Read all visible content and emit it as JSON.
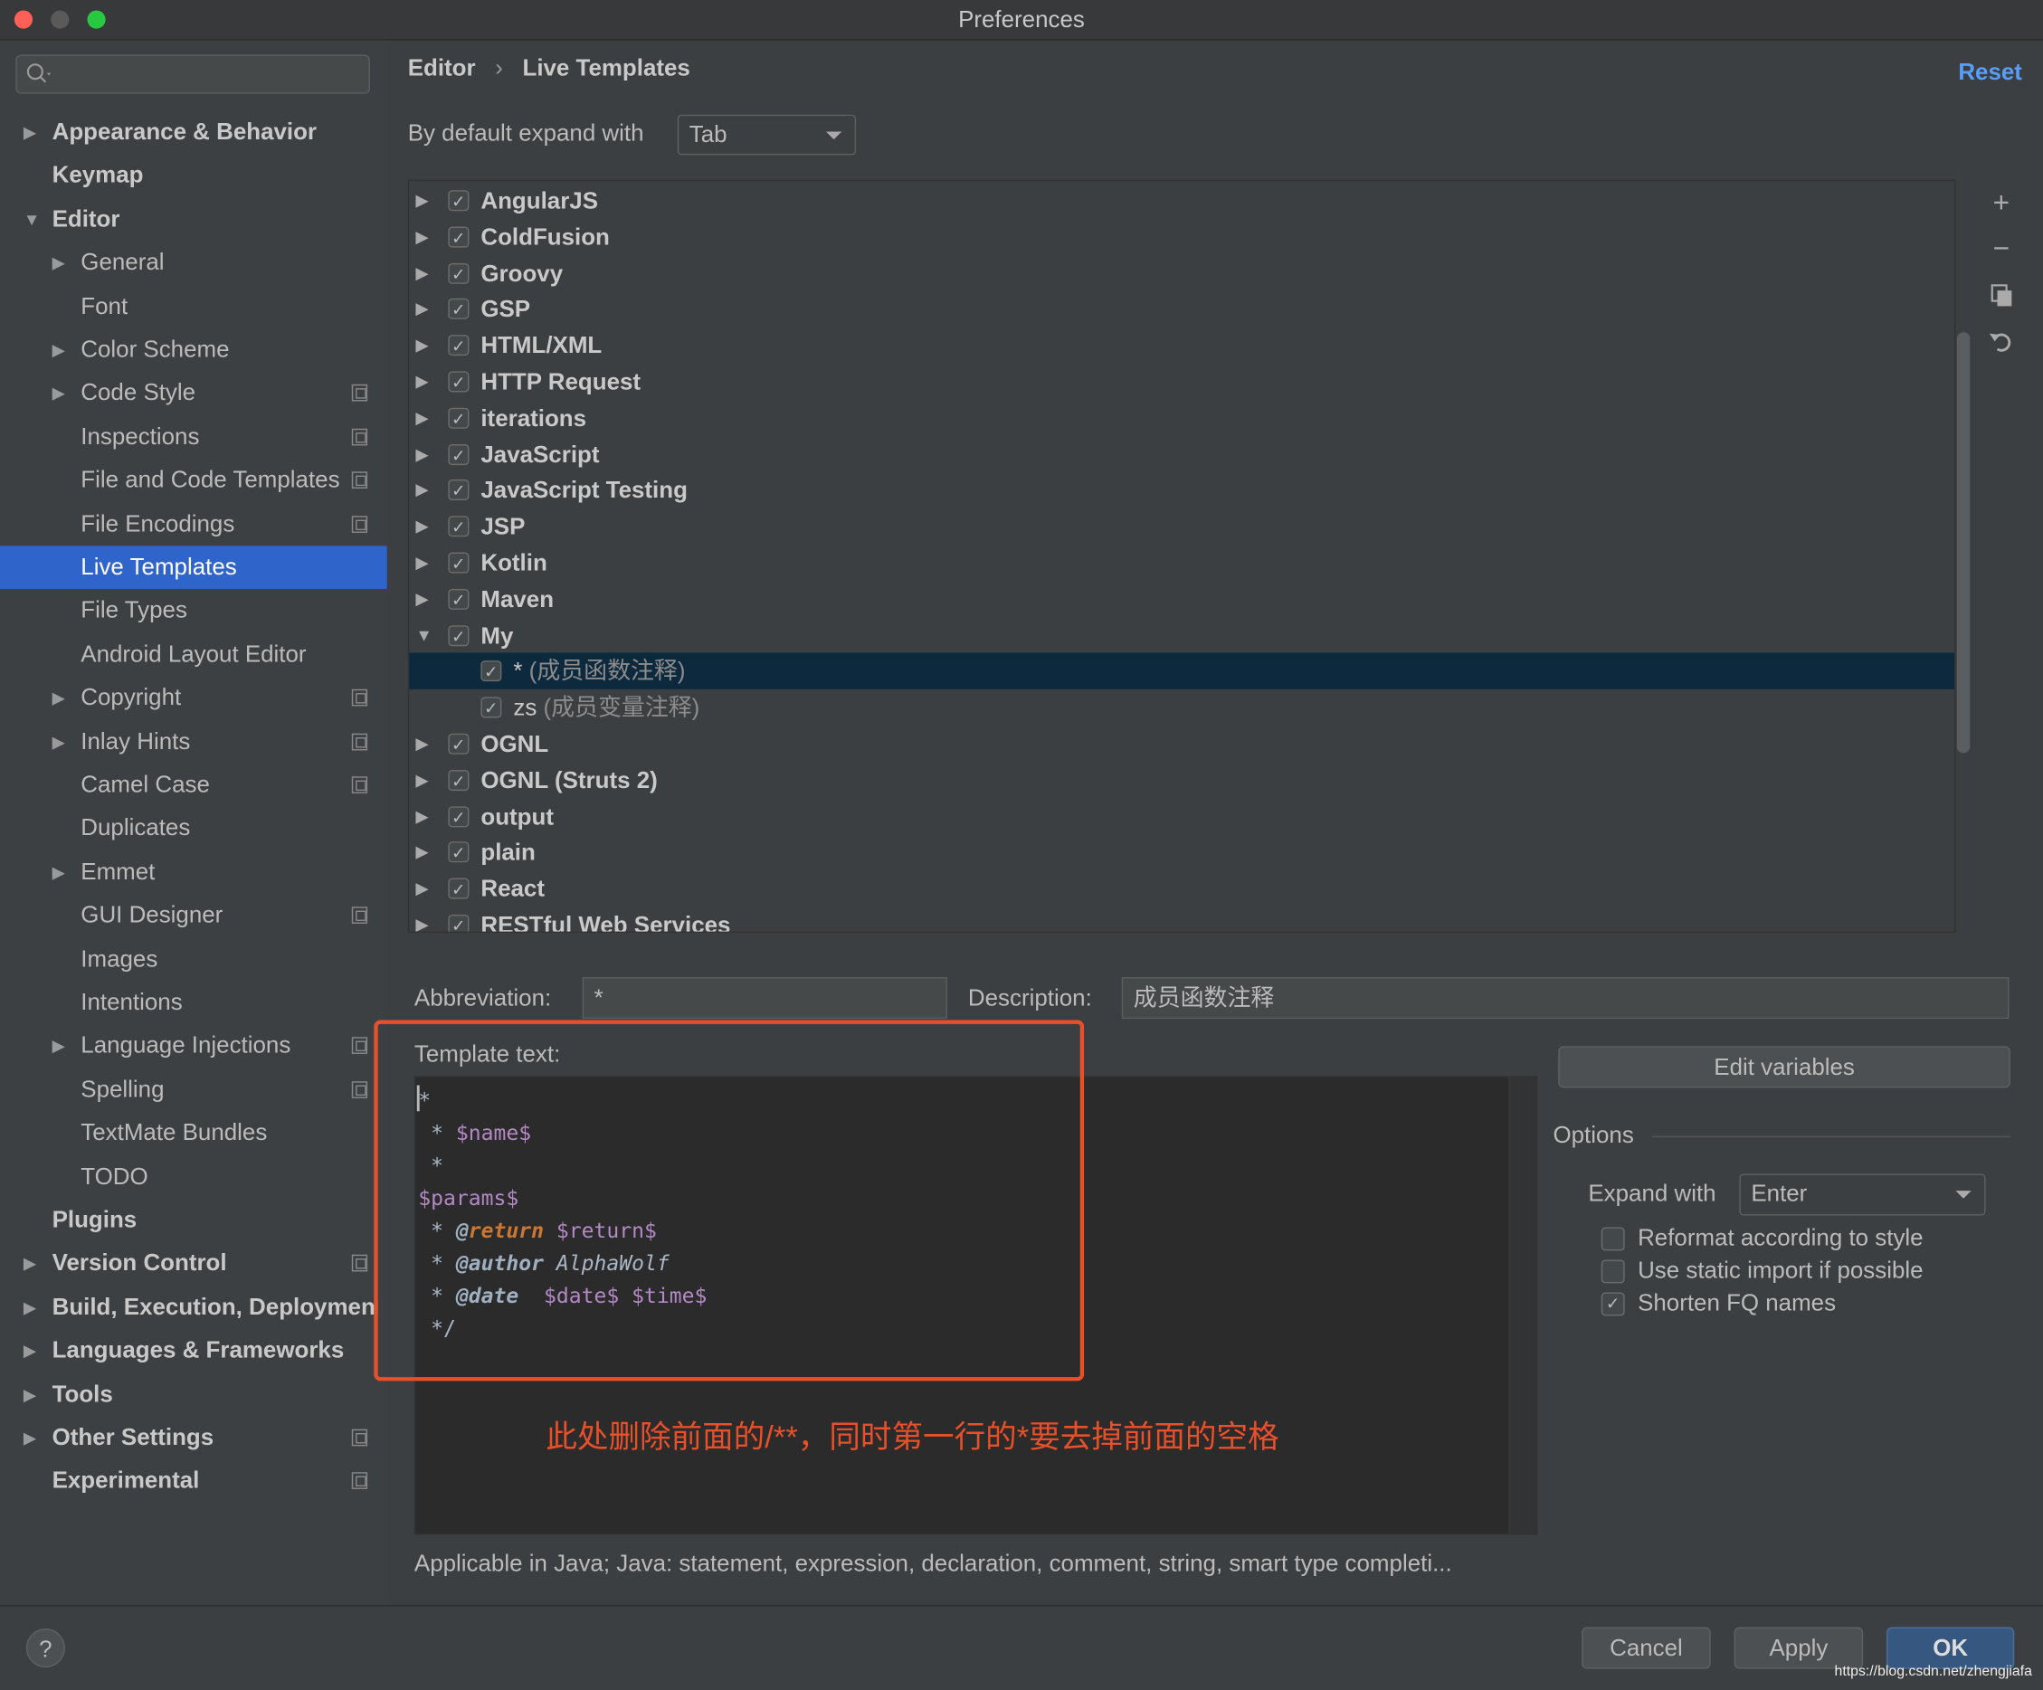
{
  "window": {
    "title": "Preferences",
    "traffic_lights": [
      "#fe5f57",
      "#5a5a5a",
      "#28c840"
    ]
  },
  "sidebar": {
    "search_placeholder": "",
    "items": [
      {
        "label": "Appearance & Behavior",
        "level": 0,
        "arrow": "right",
        "bold": true
      },
      {
        "label": "Keymap",
        "level": 0,
        "bold": true
      },
      {
        "label": "Editor",
        "level": 0,
        "arrow": "down",
        "bold": true
      },
      {
        "label": "General",
        "level": 1,
        "arrow": "right"
      },
      {
        "label": "Font",
        "level": 1
      },
      {
        "label": "Color Scheme",
        "level": 1,
        "arrow": "right"
      },
      {
        "label": "Code Style",
        "level": 1,
        "arrow": "right",
        "copy": true
      },
      {
        "label": "Inspections",
        "level": 1,
        "copy": true
      },
      {
        "label": "File and Code Templates",
        "level": 1,
        "copy": true
      },
      {
        "label": "File Encodings",
        "level": 1,
        "copy": true
      },
      {
        "label": "Live Templates",
        "level": 1,
        "selected": true
      },
      {
        "label": "File Types",
        "level": 1
      },
      {
        "label": "Android Layout Editor",
        "level": 1
      },
      {
        "label": "Copyright",
        "level": 1,
        "arrow": "right",
        "copy": true
      },
      {
        "label": "Inlay Hints",
        "level": 1,
        "arrow": "right",
        "copy": true
      },
      {
        "label": "Camel Case",
        "level": 1,
        "copy": true
      },
      {
        "label": "Duplicates",
        "level": 1
      },
      {
        "label": "Emmet",
        "level": 1,
        "arrow": "right"
      },
      {
        "label": "GUI Designer",
        "level": 1,
        "copy": true
      },
      {
        "label": "Images",
        "level": 1
      },
      {
        "label": "Intentions",
        "level": 1
      },
      {
        "label": "Language Injections",
        "level": 1,
        "arrow": "right",
        "copy": true
      },
      {
        "label": "Spelling",
        "level": 1,
        "copy": true
      },
      {
        "label": "TextMate Bundles",
        "level": 1
      },
      {
        "label": "TODO",
        "level": 1
      },
      {
        "label": "Plugins",
        "level": 0,
        "bold": true
      },
      {
        "label": "Version Control",
        "level": 0,
        "arrow": "right",
        "bold": true,
        "copy": true
      },
      {
        "label": "Build, Execution, Deployment",
        "level": 0,
        "arrow": "right",
        "bold": true
      },
      {
        "label": "Languages & Frameworks",
        "level": 0,
        "arrow": "right",
        "bold": true
      },
      {
        "label": "Tools",
        "level": 0,
        "arrow": "right",
        "bold": true
      },
      {
        "label": "Other Settings",
        "level": 0,
        "arrow": "right",
        "bold": true,
        "copy": true
      },
      {
        "label": "Experimental",
        "level": 0,
        "bold": true,
        "copy": true
      }
    ]
  },
  "header": {
    "breadcrumb": [
      "Editor",
      "Live Templates"
    ],
    "separator": "›",
    "reset": "Reset",
    "reset_color": "#589df6"
  },
  "expand_default": {
    "label": "By default expand with",
    "value": "Tab"
  },
  "tree": [
    {
      "label": "AngularJS",
      "checked": true,
      "arrow": "right"
    },
    {
      "label": "ColdFusion",
      "checked": true,
      "arrow": "right"
    },
    {
      "label": "Groovy",
      "checked": true,
      "arrow": "right"
    },
    {
      "label": "GSP",
      "checked": true,
      "arrow": "right"
    },
    {
      "label": "HTML/XML",
      "checked": true,
      "arrow": "right"
    },
    {
      "label": "HTTP Request",
      "checked": true,
      "arrow": "right"
    },
    {
      "label": "iterations",
      "checked": true,
      "arrow": "right"
    },
    {
      "label": "JavaScript",
      "checked": true,
      "arrow": "right"
    },
    {
      "label": "JavaScript Testing",
      "checked": true,
      "arrow": "right"
    },
    {
      "label": "JSP",
      "checked": true,
      "arrow": "right"
    },
    {
      "label": "Kotlin",
      "checked": true,
      "arrow": "right"
    },
    {
      "label": "Maven",
      "checked": true,
      "arrow": "right"
    },
    {
      "label": "My",
      "checked": true,
      "arrow": "down"
    },
    {
      "label": "*",
      "desc": "(成员函数注释)",
      "checked": true,
      "leaf": true,
      "selected": true
    },
    {
      "label": "zs",
      "desc": "(成员变量注释)",
      "checked": true,
      "leaf": true
    },
    {
      "label": "OGNL",
      "checked": true,
      "arrow": "right"
    },
    {
      "label": "OGNL (Struts 2)",
      "checked": true,
      "arrow": "right"
    },
    {
      "label": "output",
      "checked": true,
      "arrow": "right"
    },
    {
      "label": "plain",
      "checked": true,
      "arrow": "right"
    },
    {
      "label": "React",
      "checked": true,
      "arrow": "right"
    },
    {
      "label": "RESTful Web Services",
      "checked": true,
      "arrow": "right"
    }
  ],
  "tree_toolbar": [
    "plus-icon",
    "minus-icon",
    "copy-icon",
    "revert-icon"
  ],
  "abbreviation": {
    "label": "Abbreviation:",
    "value": "*"
  },
  "description": {
    "label": "Description:",
    "value": "成员函数注释"
  },
  "template": {
    "label": "Template text:",
    "lines": [
      [
        {
          "t": "*",
          "c": ""
        }
      ],
      [
        {
          "t": " * ",
          "c": ""
        },
        {
          "t": "$name$",
          "c": "var"
        }
      ],
      [
        {
          "t": " *",
          "c": ""
        }
      ],
      [
        {
          "t": "$params$",
          "c": "var"
        }
      ],
      [
        {
          "t": " * ",
          "c": ""
        },
        {
          "t": "@",
          "c": "tag"
        },
        {
          "t": "return",
          "c": "tag kw"
        },
        {
          "t": " ",
          "c": ""
        },
        {
          "t": "$return$",
          "c": "var"
        }
      ],
      [
        {
          "t": " * ",
          "c": ""
        },
        {
          "t": "@author",
          "c": "tag"
        },
        {
          "t": " AlphaWolf",
          "c": "it"
        }
      ],
      [
        {
          "t": " * ",
          "c": ""
        },
        {
          "t": "@date",
          "c": "tag"
        },
        {
          "t": "  ",
          "c": ""
        },
        {
          "t": "$date$",
          "c": "var"
        },
        {
          "t": " ",
          "c": ""
        },
        {
          "t": "$time$",
          "c": "var"
        }
      ],
      [
        {
          "t": " */",
          "c": ""
        }
      ]
    ],
    "annotation": "此处删除前面的/**，同时第一行的*要去掉前面的空格",
    "annotation_color": "#e8502a"
  },
  "edit_variables": "Edit variables",
  "options": {
    "title": "Options",
    "expand_label": "Expand with",
    "expand_value": "Enter",
    "checks": [
      {
        "label": "Reformat according to style",
        "checked": false
      },
      {
        "label": "Use static import if possible",
        "checked": false
      },
      {
        "label": "Shorten FQ names",
        "checked": true
      }
    ]
  },
  "applicable": "Applicable in Java; Java: statement, expression, declaration, comment, string, smart type completi...",
  "footer": {
    "help": "?",
    "cancel": "Cancel",
    "apply": "Apply",
    "ok": "OK",
    "ok_color": "#365880"
  },
  "watermark": "https://blog.csdn.net/zhengjiafa"
}
